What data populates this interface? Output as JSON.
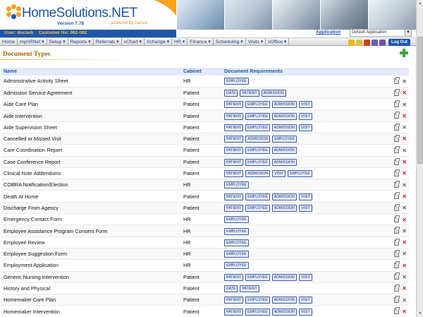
{
  "header": {
    "brand": "HomeSolutions.NET",
    "version": "Version 7.78",
    "powered": "powered by Sansio",
    "user_label": "User: doclark",
    "customer_label": "Customer No: 082-062",
    "application_label": "Application",
    "application_value": "Default Application"
  },
  "nav": {
    "items": [
      "Home",
      "myHSNet ▾",
      "Setup ▾",
      "Reports ▾",
      "Referrals ▾",
      "vChart ▾",
      "Xchange ▾",
      "HR ▾",
      "Finance ▾",
      "Scheduling ▾",
      "Visits ▾",
      "vOffice ▾"
    ],
    "logout_label": "Log Out",
    "icons": [
      "pencil-icon",
      "note-icon",
      "flag-icon",
      "envelope-icon",
      "help-icon"
    ]
  },
  "page": {
    "title": "Document Types"
  },
  "table": {
    "headers": {
      "name": "Name",
      "cabinet": "Cabinet",
      "requirements": "Document Requirements"
    },
    "rows": [
      {
        "name": "Administrative Activity Sheet",
        "cabinet": "HR",
        "reqs": [
          "EMPLOYEE"
        ],
        "del_color": "gray"
      },
      {
        "name": "Admission Service Agreement",
        "cabinet": "Patient",
        "reqs": [
          "DATE",
          "PATIENT",
          "ADMISSION"
        ],
        "del_color": "red"
      },
      {
        "name": "Aide Care Plan",
        "cabinet": "Patient",
        "reqs": [
          "PATIENT",
          "EMPLOYEE",
          "ADMISSION",
          "VISIT"
        ],
        "del_color": "gray"
      },
      {
        "name": "Aide Intervention",
        "cabinet": "Patient",
        "reqs": [
          "PATIENT",
          "EMPLOYEE",
          "ADMISSION",
          "VISIT"
        ],
        "del_color": "red"
      },
      {
        "name": "Aide Supervision Sheet",
        "cabinet": "Patient",
        "reqs": [
          "PATIENT",
          "EMPLOYEE",
          "ADMISSION",
          "VISIT"
        ],
        "del_color": "gray"
      },
      {
        "name": "Cancelled or Missed Visit",
        "cabinet": "Patient",
        "reqs": [
          "PATIENT",
          "ADMISSION",
          "EMPLOYEE"
        ],
        "del_color": "red"
      },
      {
        "name": "Care Coordination Report",
        "cabinet": "Patient",
        "reqs": [
          "PATIENT",
          "EMPLOYEE",
          "ADMISSION"
        ],
        "del_color": "gray"
      },
      {
        "name": "Case Conference Report",
        "cabinet": "Patient",
        "reqs": [
          "PATIENT",
          "EMPLOYEE",
          "ADMISSION"
        ],
        "del_color": "red"
      },
      {
        "name": "Clinical Note Addendums",
        "cabinet": "Patient",
        "reqs": [
          "PATIENT",
          "ADMISSION",
          "VISIT",
          "EMPLOYEE"
        ],
        "del_color": "red"
      },
      {
        "name": "COBRA Notification/Election",
        "cabinet": "HR",
        "reqs": [
          "EMPLOYEE"
        ],
        "del_color": "gray"
      },
      {
        "name": "Death At Home",
        "cabinet": "Patient",
        "reqs": [
          "PATIENT",
          "EMPLOYEE",
          "ADMISSION",
          "VISIT"
        ],
        "del_color": "red"
      },
      {
        "name": "Discharge From Agency",
        "cabinet": "Patient",
        "reqs": [
          "PATIENT",
          "EMPLOYEE",
          "ADMISSION",
          "VISIT"
        ],
        "del_color": "gray"
      },
      {
        "name": "Emergency Contact Form",
        "cabinet": "HR",
        "reqs": [
          "EMPLOYEE"
        ],
        "del_color": "red"
      },
      {
        "name": "Employee Assistance Program Consent Form",
        "cabinet": "HR",
        "reqs": [
          "EMPLOYEE"
        ],
        "del_color": "gray"
      },
      {
        "name": "Employee Review",
        "cabinet": "HR",
        "reqs": [
          "EMPLOYEE"
        ],
        "del_color": "red"
      },
      {
        "name": "Employee Suggestion Form",
        "cabinet": "HR",
        "reqs": [
          "EMPLOYEE"
        ],
        "del_color": "gray"
      },
      {
        "name": "Employment Application",
        "cabinet": "HR",
        "reqs": [
          "EMPLOYEE"
        ],
        "del_color": "red"
      },
      {
        "name": "Generic Nursing Intervention",
        "cabinet": "Patient",
        "reqs": [
          "PATIENT",
          "EMPLOYEE",
          "ADMISSION",
          "VISIT"
        ],
        "del_color": "gray"
      },
      {
        "name": "History and Physical",
        "cabinet": "Patient",
        "reqs": [
          "DATE",
          "PATIENT"
        ],
        "del_color": "red"
      },
      {
        "name": "Homemaker Care Plan",
        "cabinet": "Patient",
        "reqs": [
          "PATIENT",
          "EMPLOYEE",
          "ADMISSION",
          "VISIT"
        ],
        "del_color": "gray"
      },
      {
        "name": "Homemaker Intervention",
        "cabinet": "Patient",
        "reqs": [
          "PATIENT",
          "EMPLOYEE",
          "ADMISSION",
          "VISIT"
        ],
        "del_color": "red"
      }
    ]
  }
}
